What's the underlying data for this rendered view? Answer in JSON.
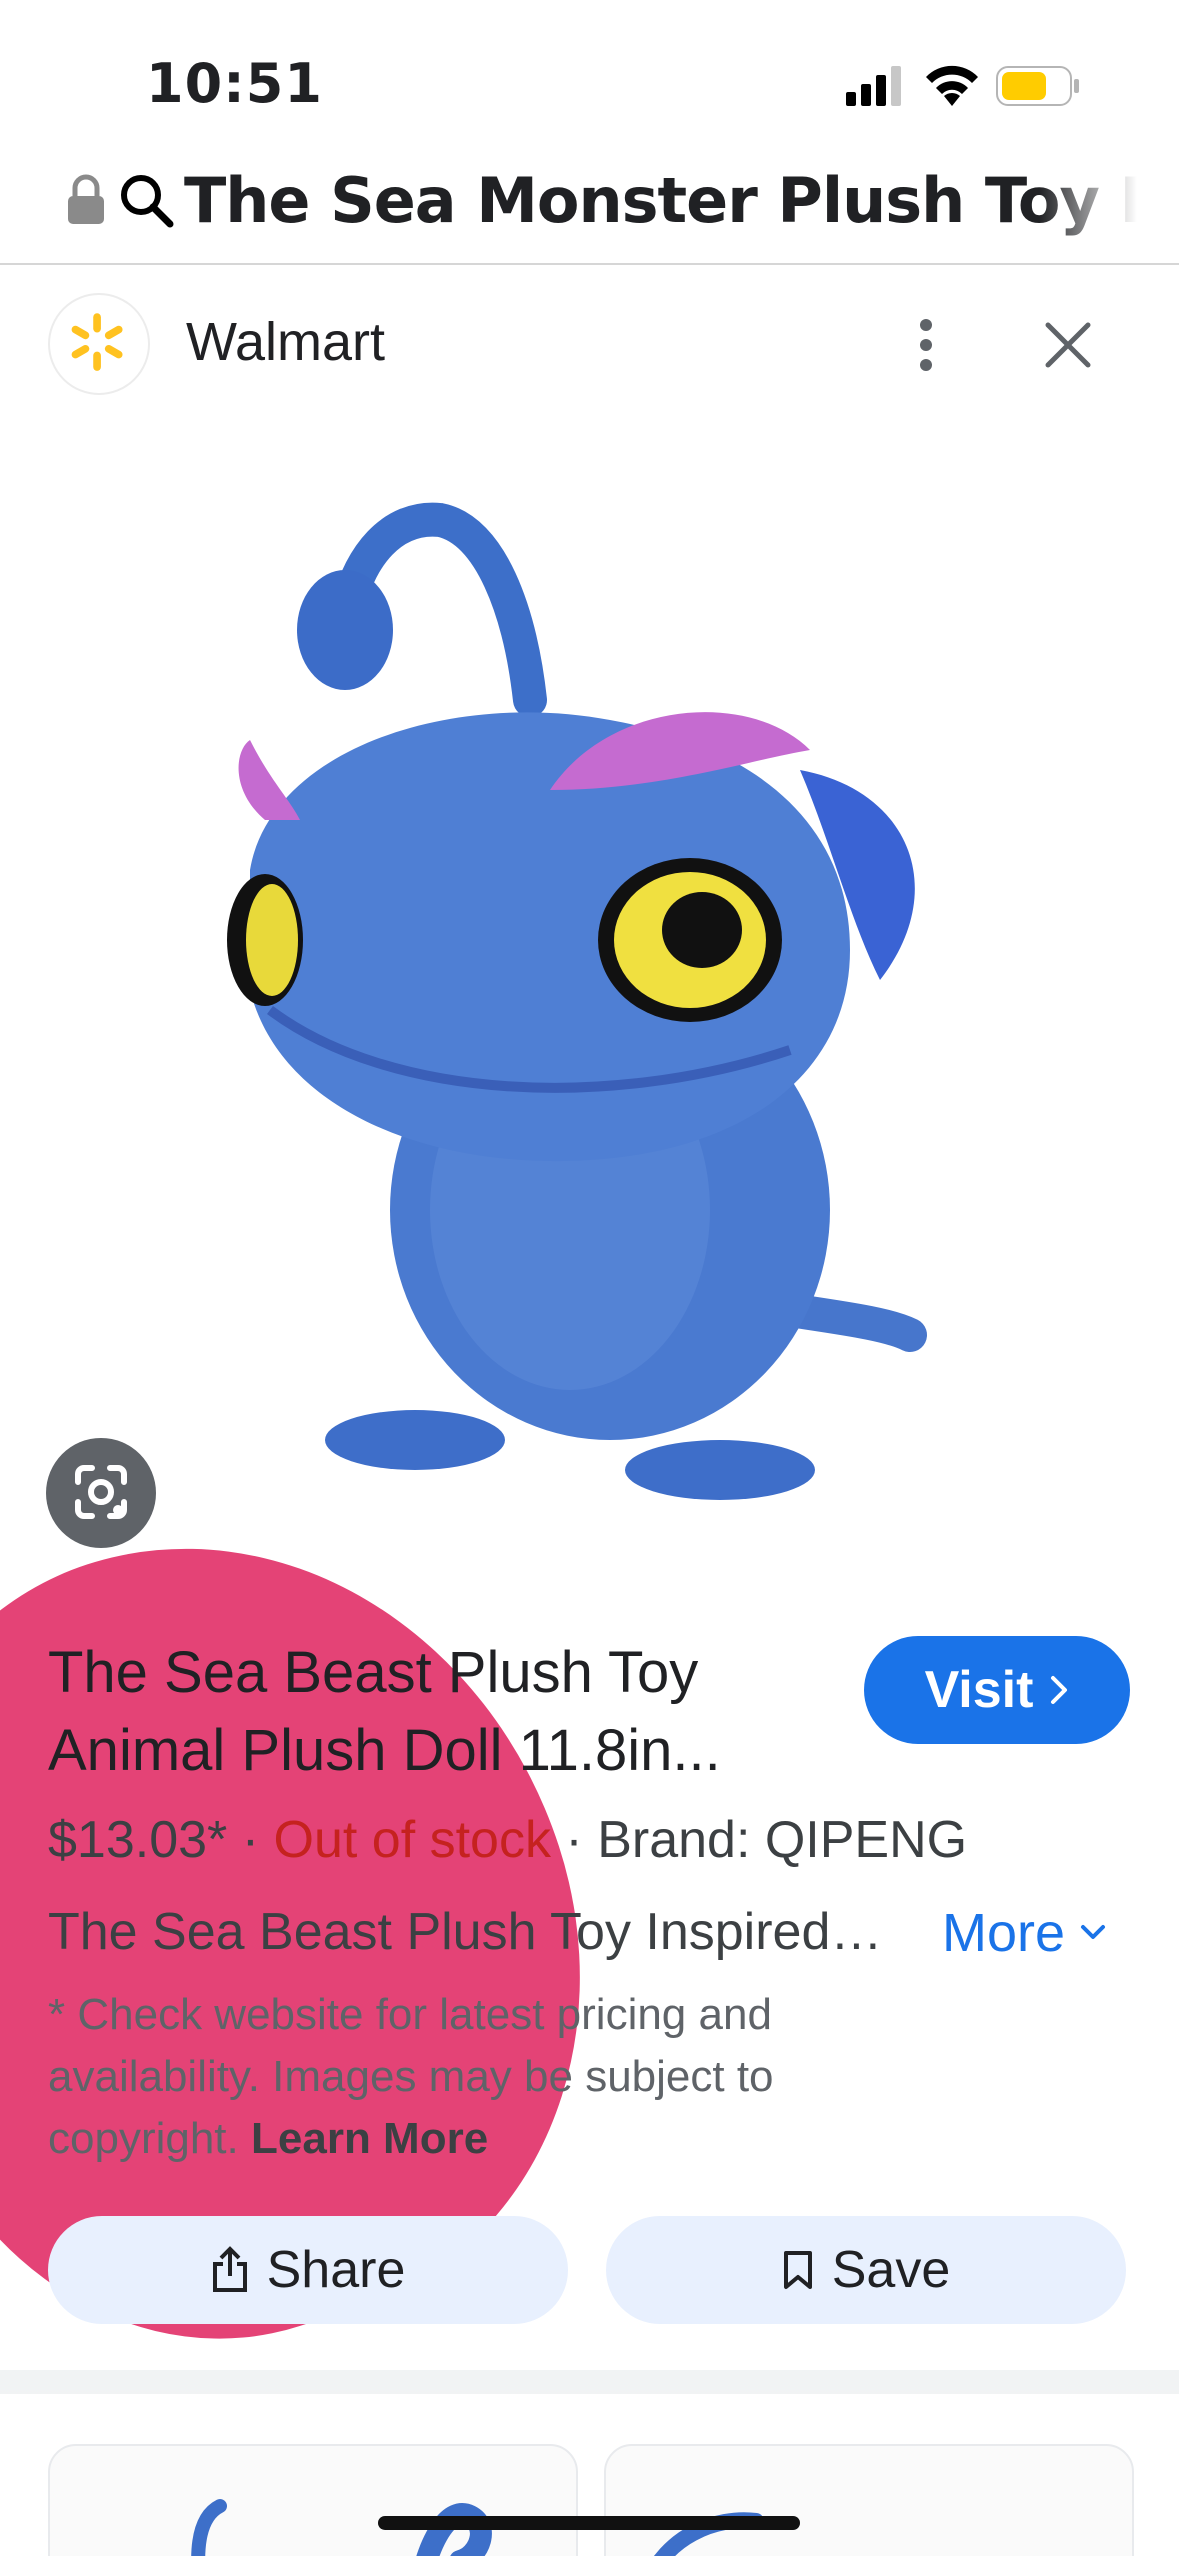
{
  "status_bar": {
    "time": "10:51"
  },
  "url_bar": {
    "text": "The Sea Monster Plush Toy Blue"
  },
  "source": {
    "name": "Walmart"
  },
  "product": {
    "title_line1": "The Sea Beast Plush Toy",
    "title_line2": "Animal Plush Doll 11.8in...",
    "visit_label": "Visit",
    "price": "$13.03*",
    "separator1": " · ",
    "stock_status": "Out of stock",
    "separator2": " · ",
    "brand": "Brand: QIPENG",
    "description": "The Sea Beast Plush Toy Inspired…",
    "more_label": "More",
    "disclaimer": "* Check website for latest pricing and availability. Images may be subject to copyright.",
    "learn_more": "Learn More"
  },
  "actions": {
    "share_label": "Share",
    "save_label": "Save"
  },
  "colors": {
    "accent": "#1a73e8",
    "out_of_stock": "#c5221f",
    "overlay_pink": "#e2336a",
    "walmart_yellow": "#ffc220"
  }
}
